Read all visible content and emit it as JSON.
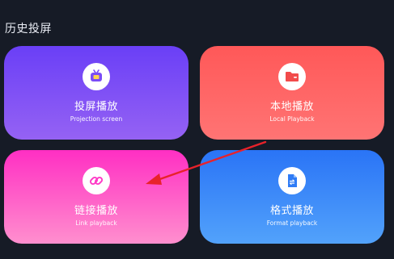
{
  "header": {
    "title": "历史投屏"
  },
  "cards": [
    {
      "title": "投屏播放",
      "subtitle": "Projection screen",
      "icon": "tv-icon"
    },
    {
      "title": "本地播放",
      "subtitle": "Local Playback",
      "icon": "folder-icon"
    },
    {
      "title": "链接播放",
      "subtitle": "Link playback",
      "icon": "link-icon"
    },
    {
      "title": "格式播放",
      "subtitle": "Format playback",
      "icon": "file-convert-icon"
    }
  ],
  "colors": {
    "background": "#161b26",
    "projection": "#7c4ff5",
    "local": "#ff5f5f",
    "link": "#ff3cc7",
    "format": "#3a86f8",
    "annotation_arrow": "#e8222a"
  }
}
